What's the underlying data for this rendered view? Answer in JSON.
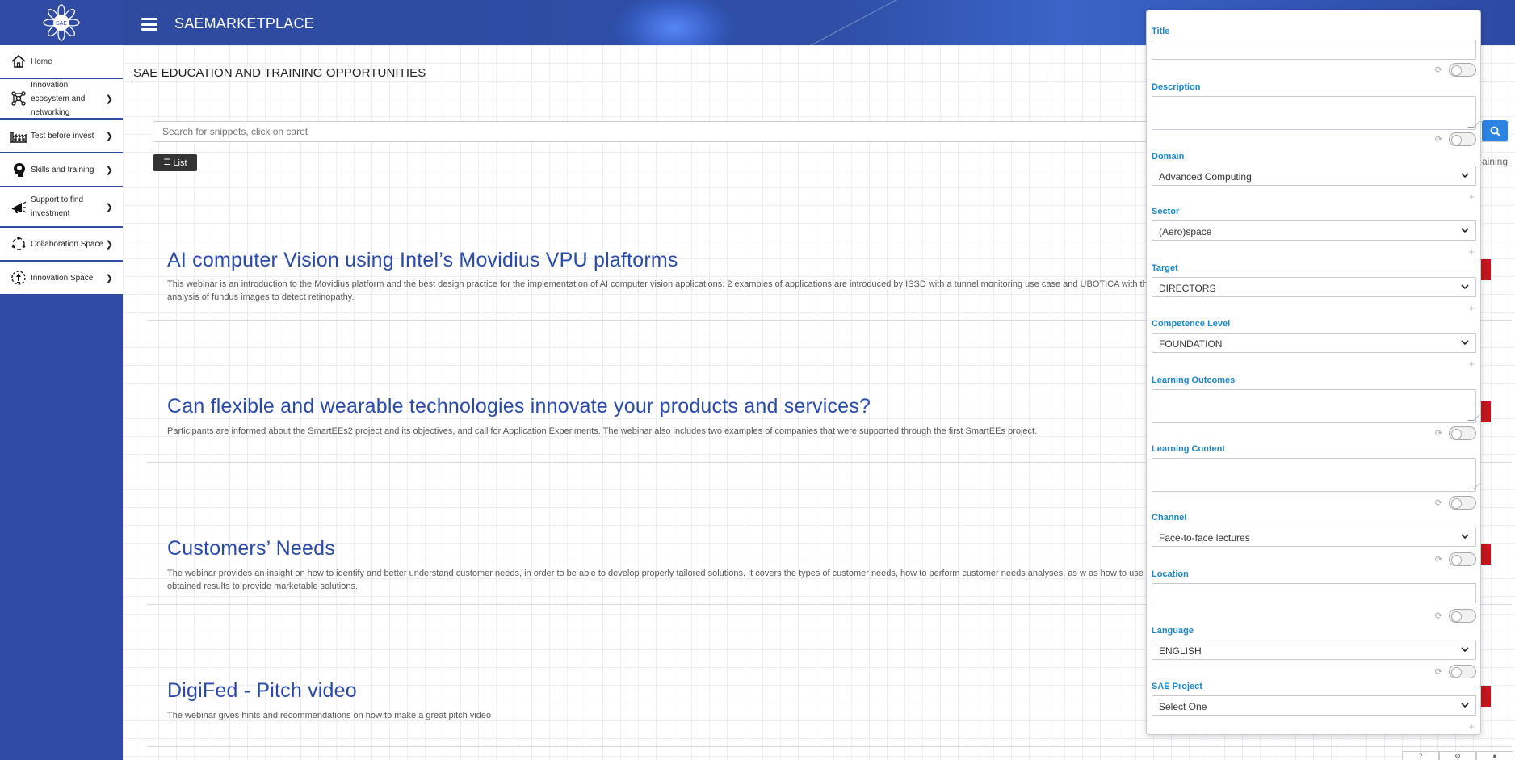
{
  "app": {
    "brand": "SAEMARKETPLACE",
    "logo_text": "SAE"
  },
  "sidebar": {
    "items": [
      {
        "label": "Home",
        "icon": "home-icon",
        "has_chevron": false
      },
      {
        "label": "Innovation ecosystem and networking",
        "icon": "network-icon",
        "has_chevron": true
      },
      {
        "label": "Test before invest",
        "icon": "factory-icon",
        "has_chevron": true
      },
      {
        "label": "Skills and training",
        "icon": "head-bulb-icon",
        "has_chevron": true
      },
      {
        "label": "Support to find investment",
        "icon": "megaphone-icon",
        "has_chevron": true
      },
      {
        "label": "Collaboration Space",
        "icon": "collaboration-icon",
        "has_chevron": true
      },
      {
        "label": "Innovation Space",
        "icon": "innovation-icon",
        "has_chevron": true
      }
    ]
  },
  "main": {
    "page_title": "SAE EDUCATION AND TRAINING OPPORTUNITIES",
    "search_placeholder": "Search for snippets, click on caret",
    "list_button": "List",
    "right_partial_label": "aining",
    "cards": [
      {
        "title": "AI computer Vision using Intel’s Movidius VPU plaftorms",
        "description": "This webinar is an introduction to the Movidius platform and the best design practice for the implementation of AI computer vision applications. 2 examples of applications are introduced by ISSD with a tunnel monitoring use case and UBOTICA with the analysis of fundus images to detect retinopathy."
      },
      {
        "title": "Can flexible and wearable technologies innovate your products and services?",
        "description": "Participants are informed about the SmartEEs2 project and its objectives, and call for Application Experiments. The webinar also includes two examples of companies that were supported through the first SmartEEs project."
      },
      {
        "title": "Customers’ Needs",
        "description": "The webinar provides an insight on how to identify and better understand customer needs, in order to be able to develop properly tailored solutions. It covers the types of customer needs, how to perform customer needs analyses, as w as how to use the obtained results to provide marketable solutions."
      },
      {
        "title": "DigiFed - Pitch video",
        "description": "The webinar gives hints and recommendations on how to make a great pitch video"
      }
    ]
  },
  "filter_panel": {
    "fields": [
      {
        "label": "Title",
        "type": "input",
        "value": ""
      },
      {
        "label": "Description",
        "type": "textarea",
        "value": ""
      },
      {
        "label": "Domain",
        "type": "select",
        "value": "Advanced Computing"
      },
      {
        "label": "Sector",
        "type": "select",
        "value": "(Aero)space"
      },
      {
        "label": "Target",
        "type": "select",
        "value": "DIRECTORS"
      },
      {
        "label": "Competence Level",
        "type": "select",
        "value": "FOUNDATION"
      },
      {
        "label": "Learning Outcomes",
        "type": "textarea",
        "value": ""
      },
      {
        "label": "Learning Content",
        "type": "textarea",
        "value": ""
      },
      {
        "label": "Channel",
        "type": "select",
        "value": "Face-to-face lectures"
      },
      {
        "label": "Location",
        "type": "input",
        "value": ""
      },
      {
        "label": "Language",
        "type": "select",
        "value": "ENGLISH"
      },
      {
        "label": "SAE Project",
        "type": "select",
        "value": "Select One"
      }
    ]
  },
  "colors": {
    "brand_blue": "#2f4ba3",
    "link_blue": "#2a4aa8",
    "label_blue": "#1a86c8",
    "accent_red": "#c4161c",
    "search_button": "#2b83e2"
  }
}
